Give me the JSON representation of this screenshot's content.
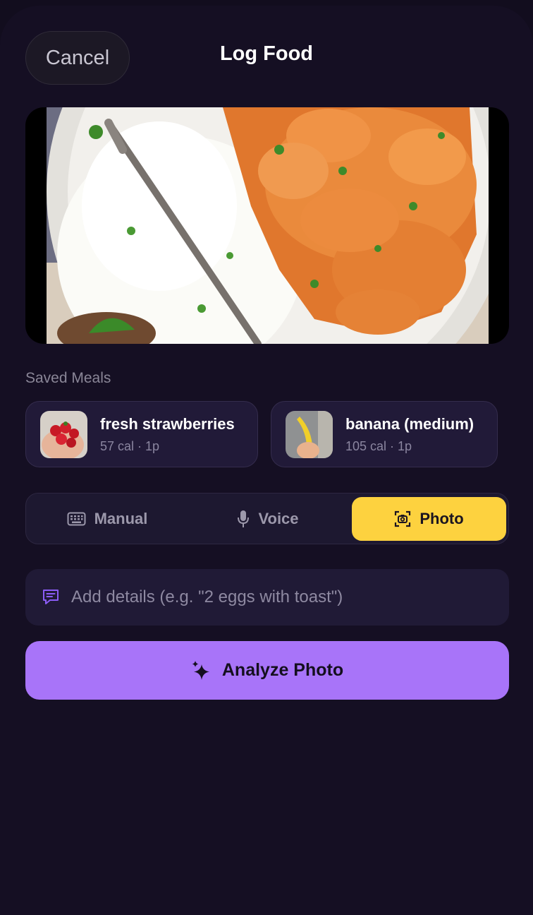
{
  "header": {
    "cancel_label": "Cancel",
    "title": "Log Food"
  },
  "photo": {
    "icon": "food-photo"
  },
  "saved_meals": {
    "label": "Saved Meals",
    "items": [
      {
        "name": "fresh strawberries",
        "meta": "57 cal · 1p"
      },
      {
        "name": "banana (medium)",
        "meta": "105 cal · 1p"
      }
    ]
  },
  "modes": {
    "manual": "Manual",
    "voice": "Voice",
    "photo": "Photo",
    "selected": "photo"
  },
  "details": {
    "placeholder": "Add details (e.g. \"2 eggs with toast\")",
    "value": ""
  },
  "analyze_label": "Analyze Photo",
  "colors": {
    "background": "#120d1e",
    "accent_purple": "#a874f9",
    "accent_yellow": "#fdd23f"
  }
}
